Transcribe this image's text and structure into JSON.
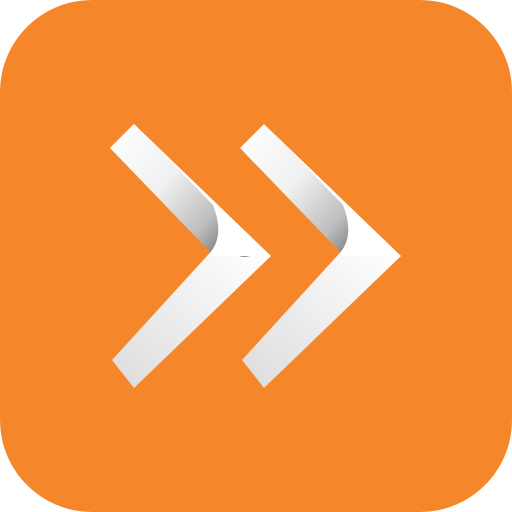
{
  "icon": {
    "name": "fast-forward-icon",
    "background_color": "#F5862A",
    "chevron_light_color": "#FFFFFF",
    "chevron_mid_color": "#E6E6E6",
    "chevron_shadow_color": "#6E6E6E"
  }
}
